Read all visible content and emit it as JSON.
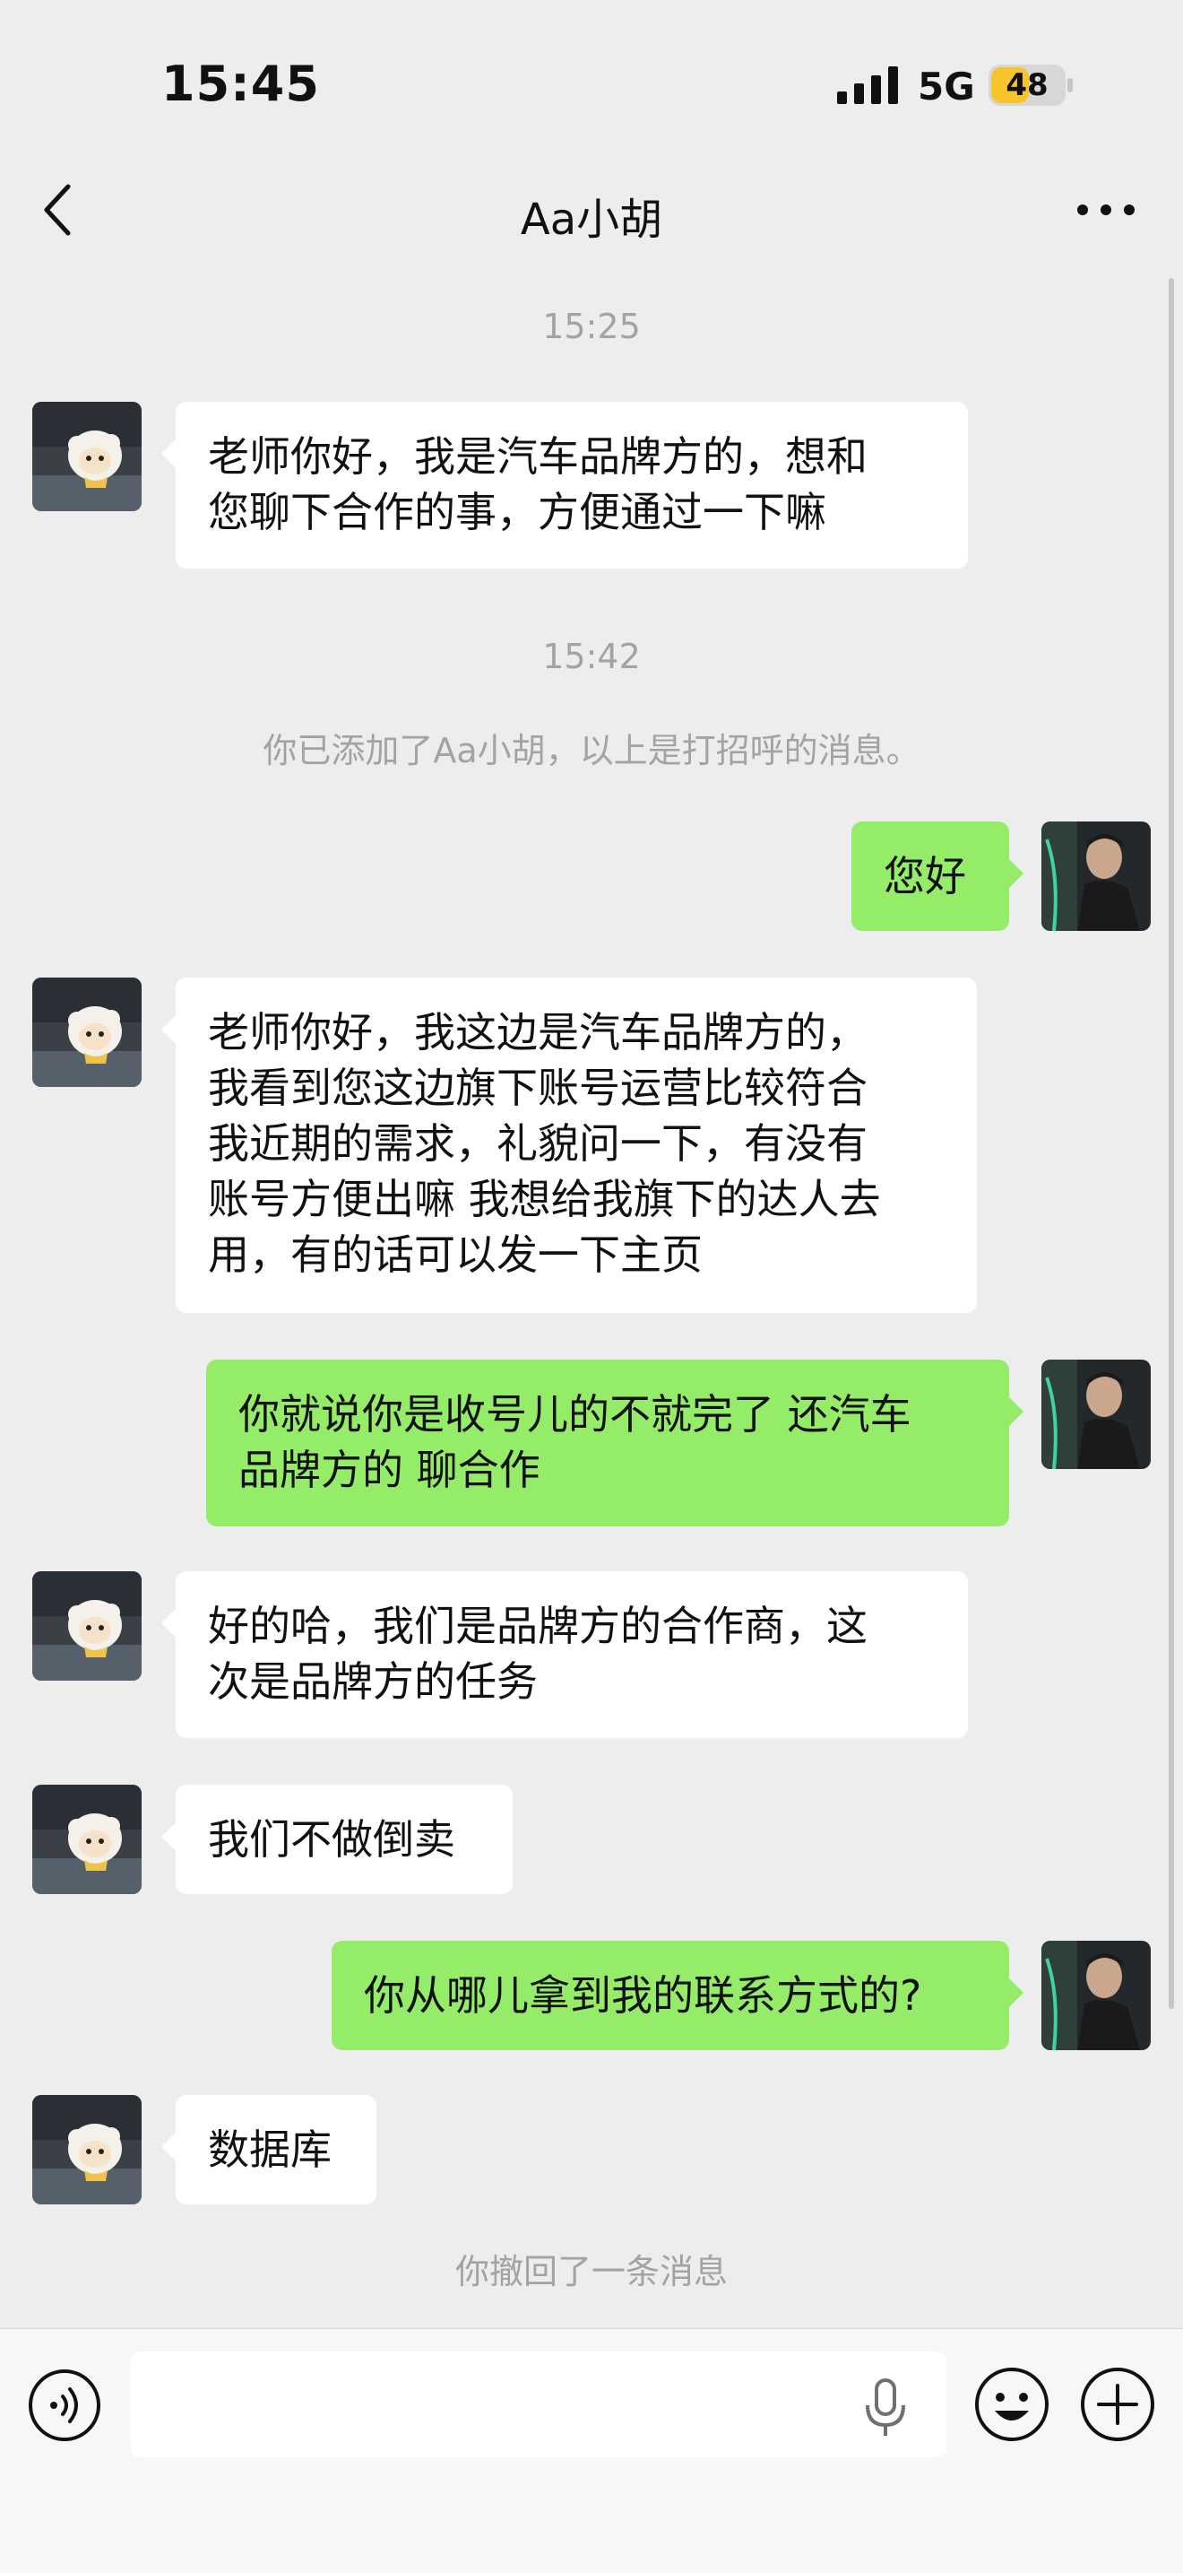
{
  "status_bar": {
    "time": "15:45",
    "network": "5G",
    "battery": "48"
  },
  "nav": {
    "title": "Aa小胡",
    "back_icon": "chevron-left-icon",
    "more_icon": "ellipsis-icon"
  },
  "messages": {
    "ts1": "15:25",
    "m1": "老师你好，我是汽车品牌方的，想和\n您聊下合作的事，方便通过一下嘛",
    "ts2": "15:42",
    "sys1": "你已添加了Aa小胡，以上是打招呼的消息。",
    "m2": "您好",
    "m3": "老师你好，我这边是汽车品牌方的，\n我看到您这边旗下账号运营比较符合\n我近期的需求，礼貌问一下，有没有\n账号方便出嘛 我想给我旗下的达人去\n用，有的话可以发一下主页",
    "m4": "你就说你是收号儿的不就完了 还汽车\n品牌方的 聊合作",
    "m5": "好的哈，我们是品牌方的合作商，这\n次是品牌方的任务",
    "m6": "我们不做倒卖",
    "m7": "你从哪儿拿到我的联系方式的?",
    "m8": "数据库",
    "sys2": "你撤回了一条消息"
  },
  "input_bar": {
    "placeholder": "",
    "voice_icon": "voice-icon",
    "mic_icon": "mic-icon",
    "emoji_icon": "emoji-icon",
    "plus_icon": "plus-icon"
  },
  "colors": {
    "background": "#ededed",
    "incoming_bubble": "#ffffff",
    "outgoing_bubble": "#95ec69",
    "battery": "#f7c52b"
  }
}
